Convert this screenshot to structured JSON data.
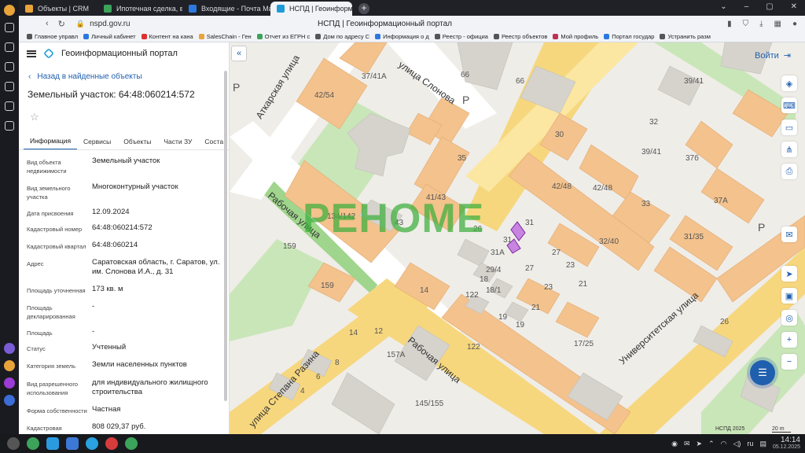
{
  "browser": {
    "tabs": [
      {
        "label": "Объекты | CRM",
        "color": "#e8a33a"
      },
      {
        "label": "Ипотечная сделка, вой",
        "color": "#3ca35a"
      },
      {
        "label": "Входящие - Почта Mail",
        "color": "#2b79e0"
      },
      {
        "label": "НСПД | Геоинформац",
        "color": "#1e9bd7",
        "active": true
      }
    ],
    "window_title": "НСПД | Геоинформационный портал",
    "url": "nspd.gov.ru",
    "bookmarks": [
      {
        "label": "Главное управл",
        "color": "#555"
      },
      {
        "label": "Личный кабинет",
        "color": "#2b79e0"
      },
      {
        "label": "Контент на кана",
        "color": "#e03030"
      },
      {
        "label": "SalesChain - Ген",
        "color": "#e8a33a"
      },
      {
        "label": "Отчет из ЕГРН с",
        "color": "#3ca35a"
      },
      {
        "label": "Дом по адресу С",
        "color": "#555"
      },
      {
        "label": "Информация о д",
        "color": "#2b79e0"
      },
      {
        "label": "Реестр - официа",
        "color": "#555"
      },
      {
        "label": "Реестр объектов",
        "color": "#555"
      },
      {
        "label": "Мой профиль",
        "color": "#c03050"
      },
      {
        "label": "Портал государ",
        "color": "#2b79e0"
      },
      {
        "label": "Устранить разм",
        "color": "#555"
      }
    ]
  },
  "portal": {
    "title": "Геоинформационный портал",
    "back_label": "Назад в найденные объекты",
    "object_title": "Земельный участок: 64:48:060214:572",
    "tabs": [
      "Информация",
      "Сервисы",
      "Объекты",
      "Части ЗУ",
      "Соста"
    ],
    "props": [
      {
        "k": "Вид объекта недвижимости",
        "v": "Земельный участок"
      },
      {
        "k": "Вид земельного участка",
        "v": "Многоконтурный участок"
      },
      {
        "k": "Дата присвоения",
        "v": "12.09.2024"
      },
      {
        "k": "Кадастровый номер",
        "v": "64:48:060214:572"
      },
      {
        "k": "Кадастровый квартал",
        "v": "64:48:060214"
      },
      {
        "k": "Адрес",
        "v": "Саратовская область, г. Саратов, ул. им. Слонова И.А., д. 31"
      },
      {
        "k": "Площадь уточненная",
        "v": "173 кв. м"
      },
      {
        "k": "Площадь декларированная",
        "v": "-"
      },
      {
        "k": "Площадь",
        "v": "-"
      },
      {
        "k": "Статус",
        "v": "Учтенный"
      },
      {
        "k": "Категория земель",
        "v": "Земли населенных пунктов"
      },
      {
        "k": "Вид разрешенного использования",
        "v": "для индивидуального жилищного строительства"
      },
      {
        "k": "Форма собственности",
        "v": "Частная"
      },
      {
        "k": "Кадастровая",
        "v": "808 029,37 руб."
      }
    ],
    "login_label": "Войти",
    "watermark": "РЕНОМЕ",
    "credit": "НСПД 2025",
    "scale": "20 m"
  },
  "map": {
    "streets": [
      {
        "label": "Аткарская улица"
      },
      {
        "label": "улица Слонова"
      },
      {
        "label": "Рабочая улица"
      },
      {
        "label": "Рабочая улица"
      },
      {
        "label": "улица Степана Разина"
      },
      {
        "label": "Университетская улица"
      }
    ],
    "buildings": [
      "37/41А",
      "42/54",
      "66",
      "66",
      "32",
      "39/41",
      "30",
      "35",
      "39/41",
      "37б",
      "42/48",
      "42/48",
      "33",
      "37А",
      "41/43",
      "134/142",
      "43",
      "31",
      "31",
      "31А",
      "26",
      "27",
      "27",
      "23",
      "23",
      "29/4",
      "18",
      "18/1",
      "122",
      "21",
      "21",
      "19",
      "19",
      "14",
      "159",
      "159",
      "32/40",
      "31/35",
      "26",
      "12",
      "122",
      "17/25",
      "157А",
      "8",
      "6",
      "4",
      "145/155",
      "14"
    ]
  },
  "taskbar": {
    "lang": "ru",
    "time": "14:14",
    "date": "05.12.2025"
  }
}
